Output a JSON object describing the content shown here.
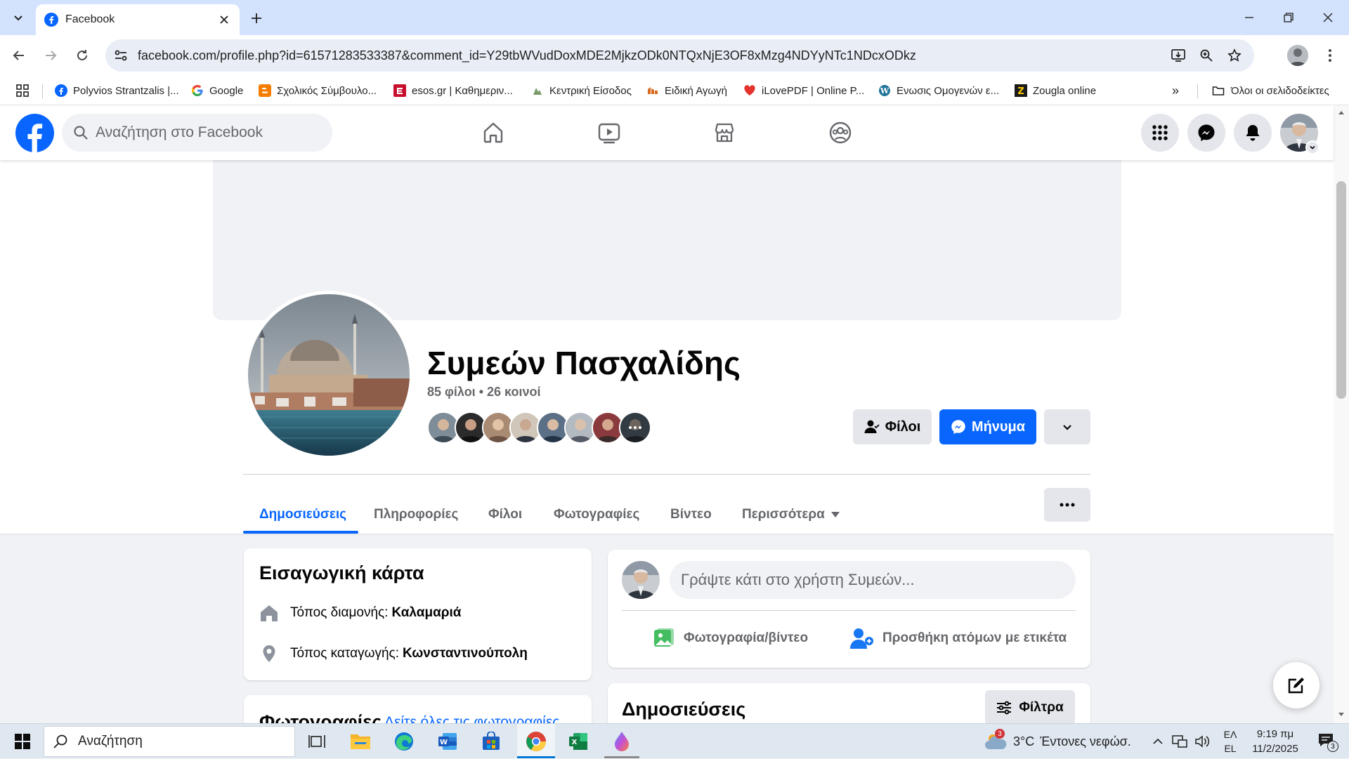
{
  "browser": {
    "tab_title": "Facebook",
    "url": "facebook.com/profile.php?id=61571283533387&comment_id=Y29tbWVudDoxMDE2MjkzODk0NTQxNjE3OF8xMzg4NDYyNTc1NDcxODkz",
    "bookmarks": [
      {
        "label": "Polyvios Strantzalis |...",
        "icon": "facebook-icon"
      },
      {
        "label": "Google",
        "icon": "google-icon"
      },
      {
        "label": "Σχολικός Σύμβουλο...",
        "icon": "blogger-icon"
      },
      {
        "label": "esos.gr | Καθημεριν...",
        "icon": "esos-icon"
      },
      {
        "label": "Κεντρική Είσοδος",
        "icon": "site-icon"
      },
      {
        "label": "Ειδική Αγωγή",
        "icon": "site-icon"
      },
      {
        "label": "iLovePDF | Online P...",
        "icon": "ilovepdf-icon"
      },
      {
        "label": "Ενωσις Ομογενών ε...",
        "icon": "wordpress-icon"
      },
      {
        "label": "Zougla online",
        "icon": "zougla-icon"
      }
    ],
    "all_bookmarks": "Όλοι οι σελιδοδείκτες",
    "overflow": "»"
  },
  "fb": {
    "search_placeholder": "Αναζήτηση στο Facebook",
    "brand_color": "#0866ff"
  },
  "profile": {
    "name": "Συμεών Πασχαλίδης",
    "friend_count": "85 φίλοι • 26 κοινοί",
    "friends_button": "Φίλοι",
    "message_button": "Μήνυμα",
    "tabs": [
      {
        "label": "Δημοσιεύσεις",
        "active": true
      },
      {
        "label": "Πληροφορίες",
        "active": false
      },
      {
        "label": "Φίλοι",
        "active": false
      },
      {
        "label": "Φωτογραφίες",
        "active": false
      },
      {
        "label": "Βίντεο",
        "active": false
      },
      {
        "label": "Περισσότερα",
        "active": false
      }
    ],
    "more_menu_icon": "ellipsis-icon"
  },
  "intro": {
    "title": "Εισαγωγική κάρτα",
    "lives_label": "Τόπος διαμονής: ",
    "lives_value": "Καλαμαριά",
    "from_label": "Τόπος καταγωγής: ",
    "from_value": "Κωνσταντινούπολη"
  },
  "photos": {
    "title": "Φωτογραφίες",
    "see_all": "Δείτε όλες τις φωτογραφίες"
  },
  "composer": {
    "placeholder": "Γράψτε κάτι στο χρήστη Συμεών...",
    "photo_video": "Φωτογραφία/βίντεο",
    "tag_people": "Προσθήκη ατόμων με ετικέτα"
  },
  "posts": {
    "title": "Δημοσιεύσεις",
    "filters": "Φίλτρα"
  },
  "taskbar": {
    "search": "Αναζήτηση",
    "weather_temp": "3°C",
    "weather_text": "Έντονες νεφώσ.",
    "weather_badge": "3",
    "lang_top": "ΕΛ",
    "lang_bottom": "EL",
    "time": "9:19 πμ",
    "date": "11/2/2025",
    "notif_count": "3"
  }
}
